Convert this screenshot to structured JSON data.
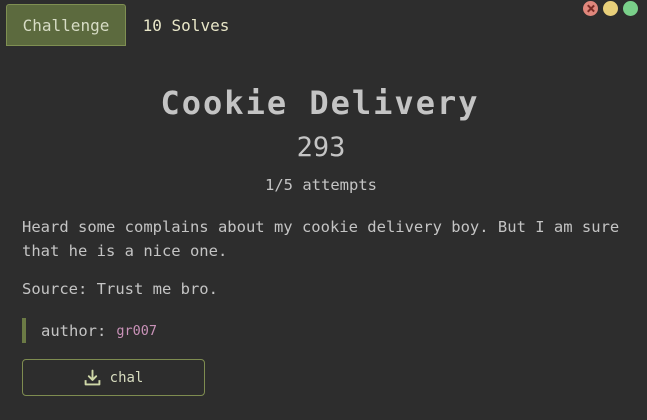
{
  "tabs": [
    {
      "label": "Challenge",
      "active": true
    },
    {
      "label": "10 Solves",
      "active": false
    }
  ],
  "window_controls": {
    "close_color": "#e0877c",
    "minimize_color": "#e8cf7a",
    "maximize_color": "#7ad08a"
  },
  "challenge": {
    "title": "Cookie Delivery",
    "points": "293",
    "attempts": "1/5 attempts",
    "description": "Heard some complains about my cookie delivery boy. But I am sure that he is a nice one.",
    "source": "Source: Trust me bro.",
    "author_label": "author:",
    "author_name": "gr007"
  },
  "files": [
    {
      "label": "chal",
      "icon": "download-icon"
    }
  ],
  "colors": {
    "background": "#2d2d2d",
    "accent": "#5c6a3e",
    "accent_border": "#7f8f52",
    "author_name": "#c992b8"
  }
}
